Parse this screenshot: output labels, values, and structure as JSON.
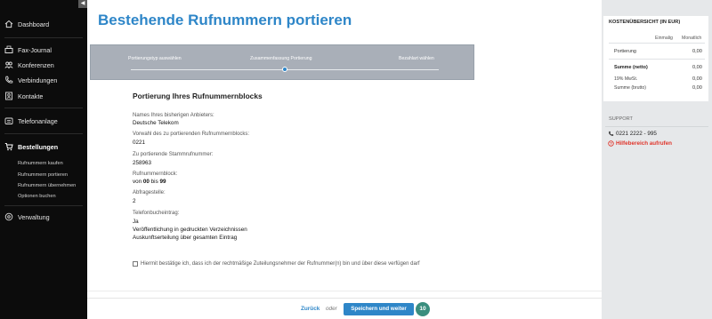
{
  "sidebar": {
    "items": [
      {
        "label": "Dashboard",
        "icon": "home-icon"
      },
      {
        "label": "Fax-Journal",
        "icon": "fax-icon"
      },
      {
        "label": "Konferenzen",
        "icon": "conference-icon"
      },
      {
        "label": "Verbindungen",
        "icon": "phone-icon"
      },
      {
        "label": "Kontakte",
        "icon": "contacts-icon"
      },
      {
        "label": "Telefonanlage",
        "icon": "telephone-system-icon"
      },
      {
        "label": "Bestellungen",
        "icon": "cart-icon"
      },
      {
        "label": "Verwaltung",
        "icon": "settings-icon"
      }
    ],
    "sub_items": [
      {
        "label": "Rufnummern kaufen"
      },
      {
        "label": "Rufnummern portieren"
      },
      {
        "label": "Rufnummern übernehmen"
      },
      {
        "label": "Optionen buchen"
      }
    ],
    "collapse_glyph": "◀"
  },
  "main": {
    "title": "Bestehende Rufnummern portieren",
    "steps": [
      {
        "label": "Portierungstyp auswählen"
      },
      {
        "label": "Zusammenfassung Portierung"
      },
      {
        "label": "Bezahlart wählen"
      }
    ],
    "section_title": "Portierung Ihres Rufnummernblocks",
    "fields": [
      {
        "label": "Names Ihres bisherigen Anbieters:",
        "value": "Deutsche Telekom"
      },
      {
        "label": "Vorwahl des zu portierenden Rufnummernblocks:",
        "value": "0221"
      },
      {
        "label": "Zu portierende Stammrufnummer:",
        "value": "258963"
      }
    ],
    "block": {
      "label": "Rufnummernblock:",
      "from_word": "von",
      "from": "00",
      "to_word": "bis",
      "to": "99"
    },
    "extension": {
      "label": "Abfragestelle:",
      "value": "2"
    },
    "phonebook": {
      "label": "Telefonbucheintrag:",
      "lines": [
        "Ja",
        "Veröffentlichung in gedruckten Verzeichnissen",
        "Auskunftserteilung über gesamten Eintrag"
      ]
    },
    "confirmation": "Hiermit bestätige ich, dass ich der rechtmäßige Zuteilungsnehmer der Rufnummer(n) bin und über diese verfügen darf"
  },
  "costs": {
    "title": "KOSTENÜBERSICHT (IN EUR)",
    "col_once": "Einmalig",
    "col_monthly": "Monatlich",
    "rows": [
      {
        "label": "Portierung",
        "value": "0,00"
      },
      {
        "label": "Summe (netto)",
        "value": "0,00"
      },
      {
        "label": "19% MwSt.",
        "value": "0,00"
      },
      {
        "label": "Summe (brutto)",
        "value": "0,00"
      }
    ]
  },
  "support": {
    "title": "SUPPORT",
    "phone": "0221 2222 - 995",
    "help_link": "Hilfebereich aufrufen"
  },
  "footer": {
    "back_label": "Zurück",
    "or_label": "oder",
    "save_label": "Speichern und weiter",
    "badge": "10"
  },
  "colors": {
    "accent": "#2e86c8",
    "sidebar_bg": "#0c0c0c",
    "stepper_bg": "#a9afb8",
    "help_link": "#e0352b",
    "badge": "#3a8e7e"
  }
}
